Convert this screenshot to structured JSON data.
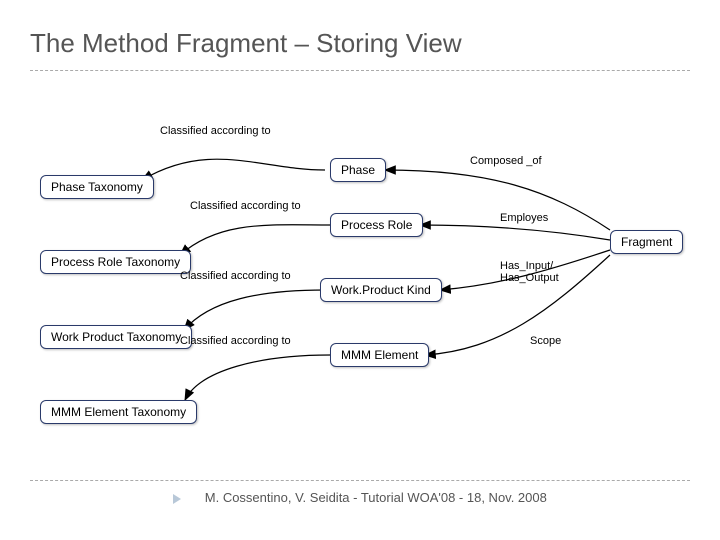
{
  "title": "The Method Fragment – Storing View",
  "footer": "M. Cossentino, V. Seidita - Tutorial WOA'08 - 18, Nov. 2008",
  "nodes": {
    "phase_taxonomy": "Phase Taxonomy",
    "process_role_taxonomy": "Process Role Taxonomy",
    "work_product_taxonomy": "Work Product Taxonomy",
    "mmm_element_taxonomy": "MMM Element Taxonomy",
    "phase": "Phase",
    "process_role": "Process Role",
    "work_product_kind": "Work.Product Kind",
    "mmm_element": "MMM Element",
    "fragment": "Fragment"
  },
  "edges": {
    "classified_1": "Classified according to",
    "classified_2": "Classified according to",
    "classified_3": "Classified according to",
    "classified_4": "Classified according to",
    "composed_of": "Composed _of",
    "employes": "Employes",
    "has_io": "Has_Input/\nHas_Output",
    "scope": "Scope"
  }
}
